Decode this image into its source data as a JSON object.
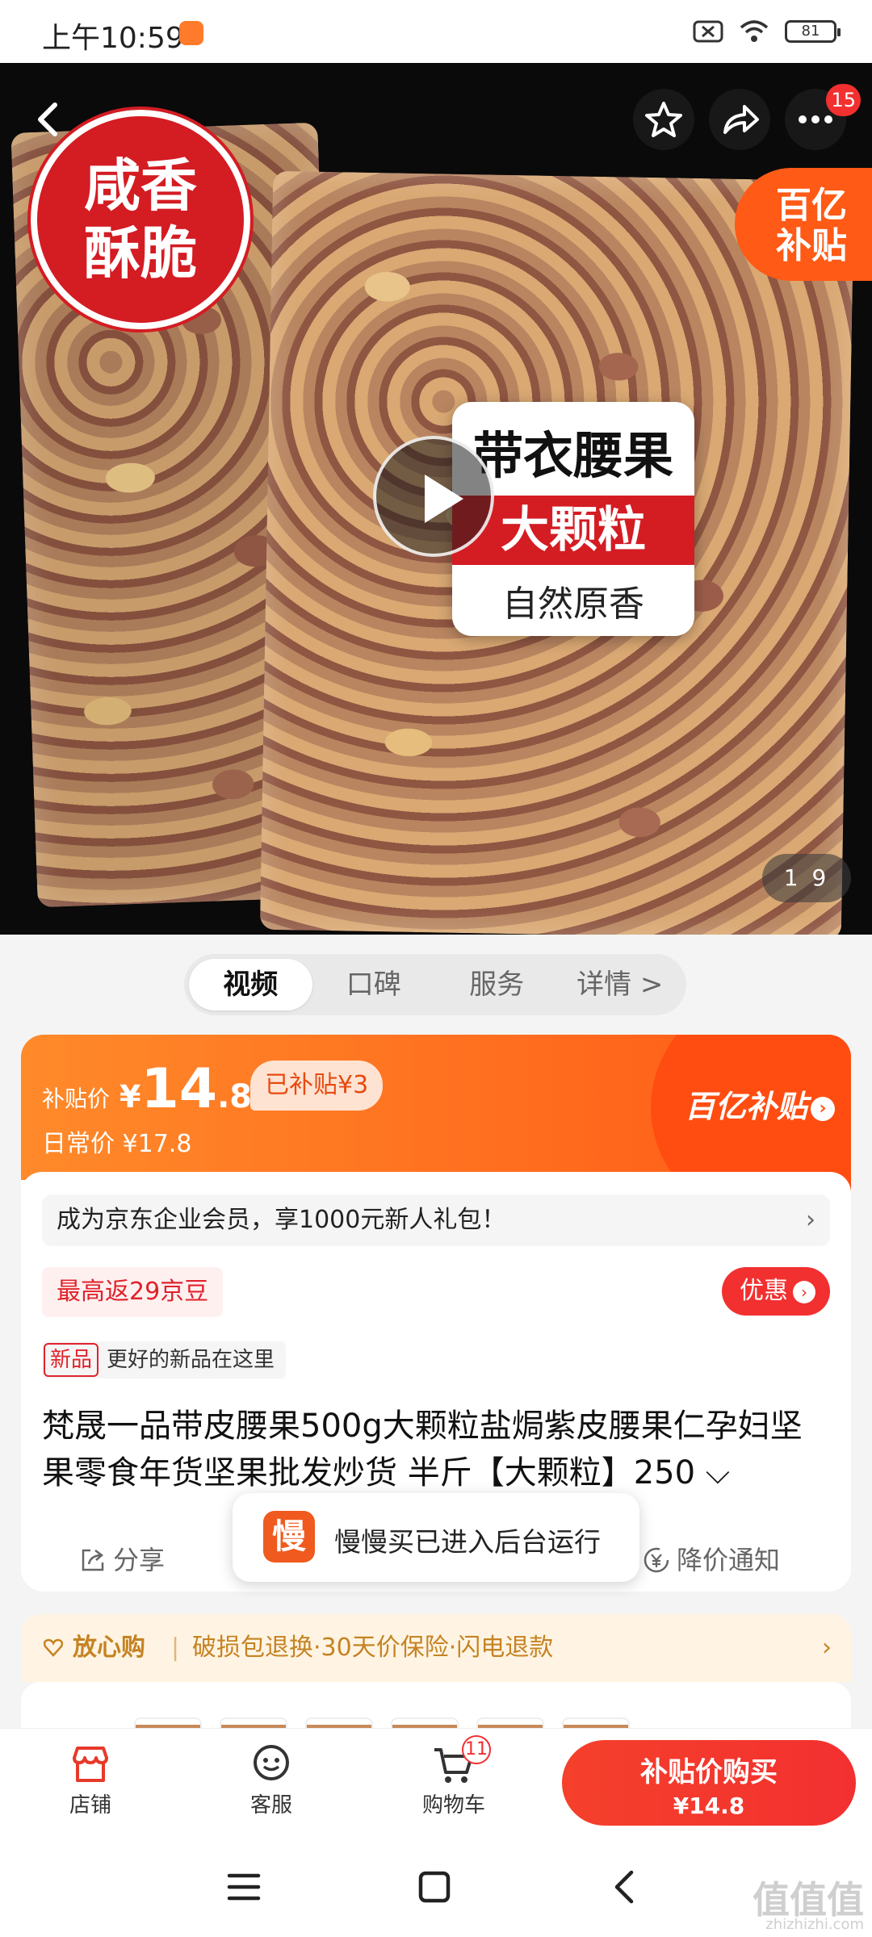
{
  "status_bar": {
    "time": "上午10:59",
    "battery": "81"
  },
  "hero": {
    "seal_line1": "咸香",
    "seal_line2": "酥脆",
    "subsidy_tag_line1": "百亿",
    "subsidy_tag_line2": "补贴",
    "card_line1": "带衣腰果",
    "card_line2": "大颗粒",
    "card_line3": "自然原香",
    "more_badge": "15",
    "pager": "1 9"
  },
  "tabs": [
    "视频",
    "口碑",
    "服务",
    "详情 >"
  ],
  "price": {
    "subsidy_label": "补贴价",
    "currency": "¥",
    "integer": "14",
    "decimal": ".8",
    "subsidized_tag": "已补贴¥3",
    "daily_price": "日常价 ¥17.8",
    "brand": "百亿补贴",
    "brand_arrow": "›"
  },
  "promo": {
    "member_text": "成为京东企业会员，享1000元新人礼包！",
    "member_chev": "›",
    "beans": "最高返29京豆",
    "discount": "优惠",
    "discount_arrow": "›",
    "new_tag": "新品",
    "new_text": "更好的新品在这里"
  },
  "product_title": "梵晟一品带皮腰果500g大颗粒盐焗紫皮腰果仁孕妇坚果零食年货坚果批发炒货 半斤【大颗粒】250 ⌵",
  "actions": {
    "share": "分享",
    "price_alert": "降价通知"
  },
  "toast": {
    "logo": "慢",
    "text": "慢慢买已进入后台运行"
  },
  "assurance": {
    "label": "放心购",
    "items": "破损包退换·30天价保险·闪电退款",
    "chev": "›"
  },
  "bottom_bar": {
    "store": "店铺",
    "service": "客服",
    "cart": "购物车",
    "cart_badge": "11",
    "buy_line1": "补贴价购买",
    "buy_line2": "¥14.8"
  },
  "watermark": {
    "main": "值值值",
    "sub": "zhizhizhi.com"
  },
  "colors": {
    "accent": "#ff5a16",
    "red": "#f23030"
  }
}
